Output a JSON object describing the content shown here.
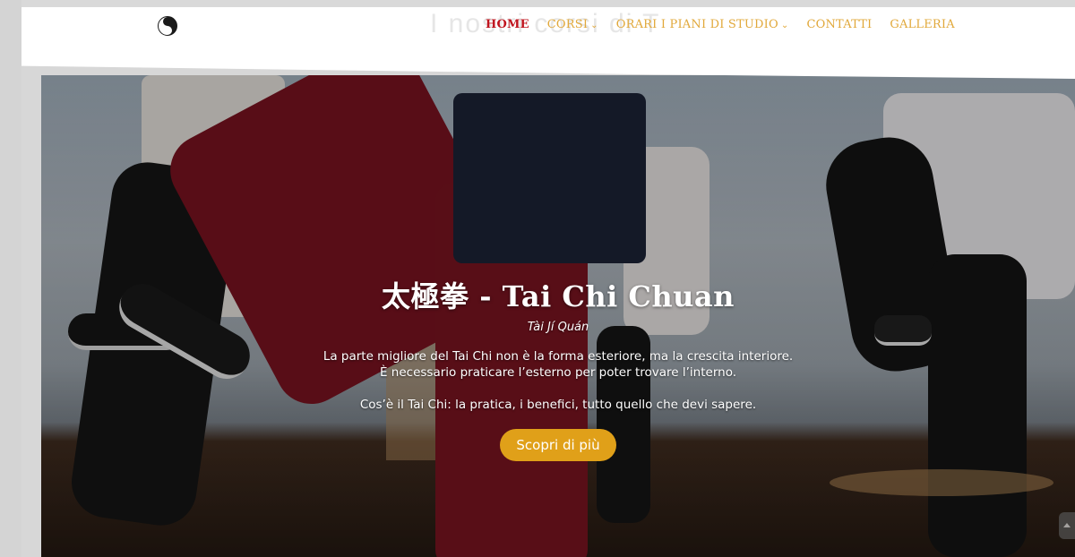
{
  "header": {
    "ghost_text": "I nostri corsi di T",
    "nav": [
      {
        "label": "HOME",
        "active": true,
        "dropdown": false
      },
      {
        "label": "CORSI",
        "active": false,
        "dropdown": true
      },
      {
        "label": "ORARI I PIANI DI STUDIO",
        "active": false,
        "dropdown": true
      },
      {
        "label": "CONTATTI",
        "active": false,
        "dropdown": false
      },
      {
        "label": "GALLERIA",
        "active": false,
        "dropdown": false
      }
    ],
    "dropdown_glyph": "⌄"
  },
  "hero": {
    "title": "太極拳 - Tai Chi Chuan",
    "subtitle": "Tài Jí Quán",
    "quote_line1": "La parte migliore del Tai Chi non è la forma esteriore, ma la crescita interiore.",
    "quote_line2": "È necessario praticare l’esterno per poter trovare l’interno.",
    "lead": "Cos’è il Tai Chi: la pratica, i benefici, tutto quello che devi sapere.",
    "button_label": "Scopri di più"
  },
  "colors": {
    "accent": "#e0a019",
    "nav_active": "#c0141e",
    "nav_link": "#e1a83a"
  },
  "icons": {
    "logo": "yin-yang-icon",
    "scroll": "chevron-up-icon"
  }
}
